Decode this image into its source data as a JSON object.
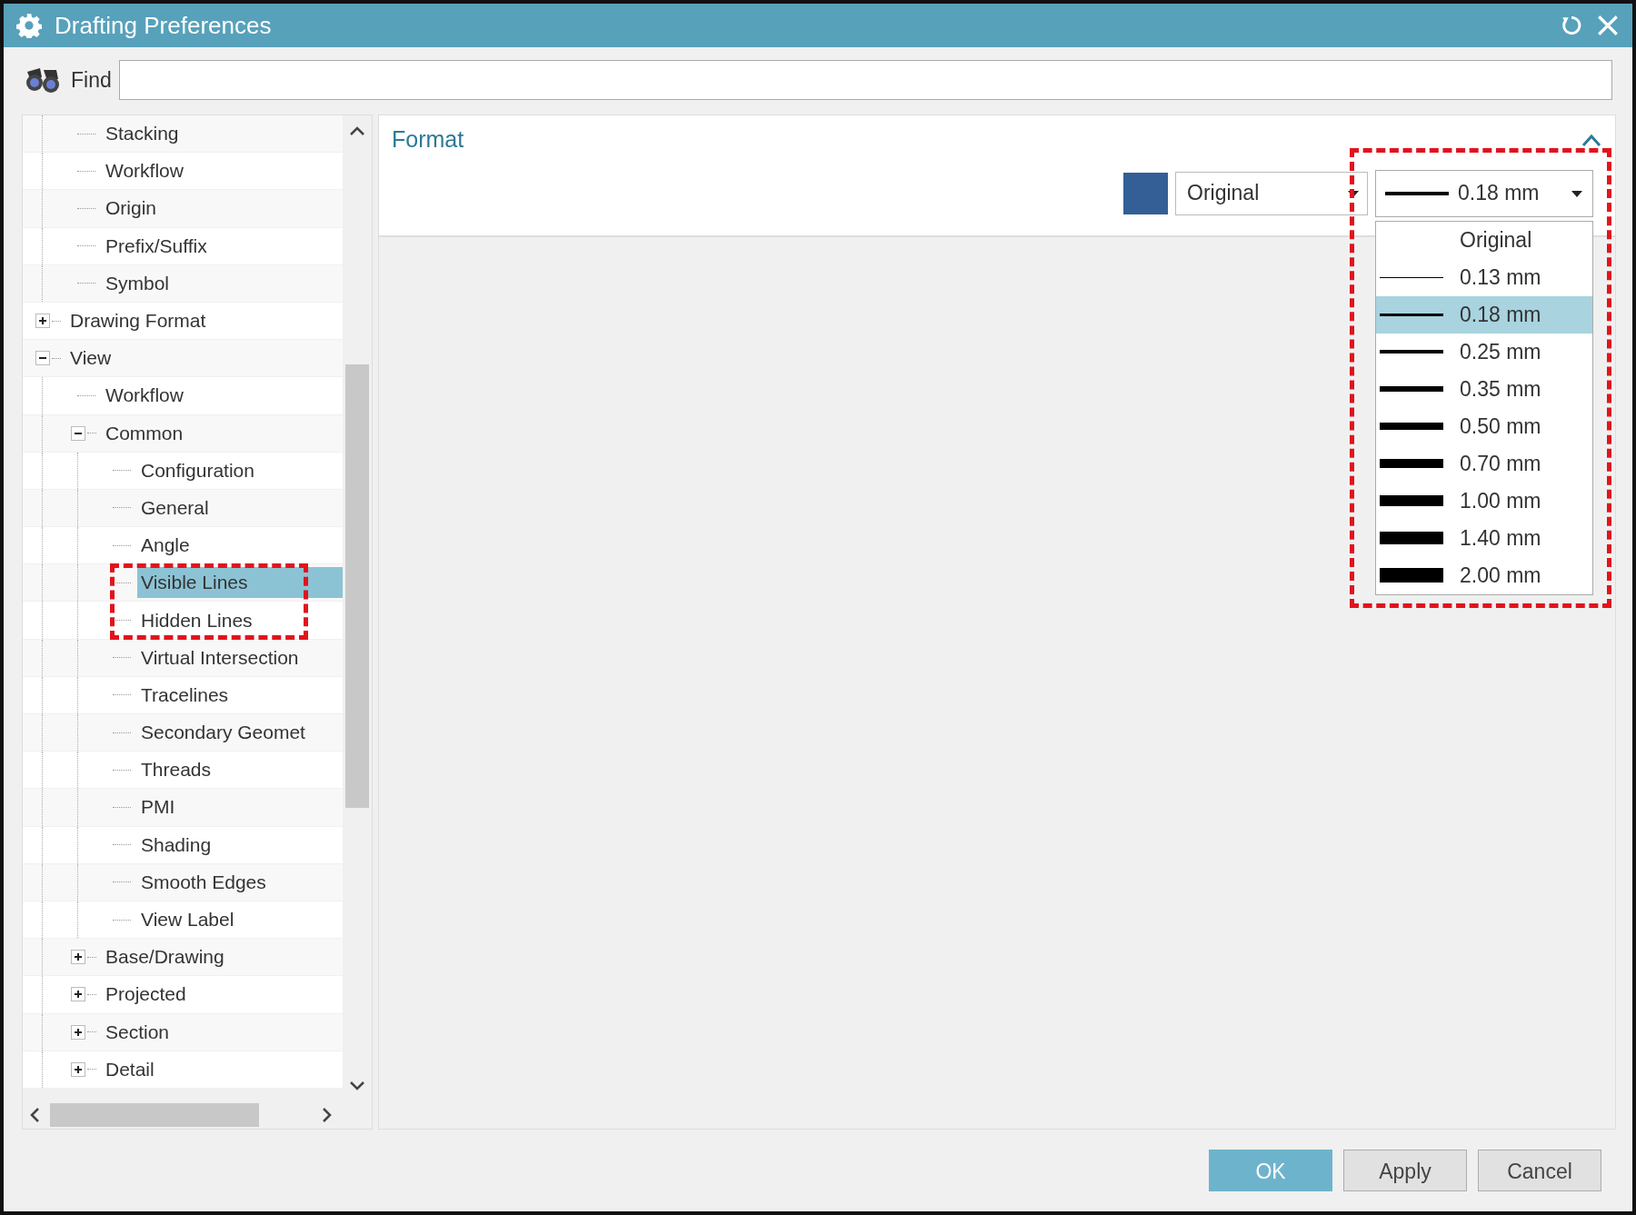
{
  "window": {
    "title": "Drafting Preferences"
  },
  "find": {
    "label": "Find"
  },
  "tree": {
    "items": [
      {
        "children": [
          {
            "label": "Stacking",
            "selected": false,
            "highlighted": false
          },
          {
            "label": "Workflow",
            "selected": false,
            "highlighted": false
          },
          {
            "label": "Origin",
            "selected": false,
            "highlighted": false
          },
          {
            "label": "Prefix/Suffix",
            "selected": false,
            "highlighted": false
          },
          {
            "label": "Symbol",
            "selected": false,
            "highlighted": false
          }
        ]
      },
      {
        "label": "Drawing Format",
        "expanded": false,
        "selected": false,
        "highlighted": false
      },
      {
        "label": "View",
        "expanded": true,
        "selected": false,
        "highlighted": false,
        "children": [
          {
            "label": "Workflow",
            "selected": false,
            "highlighted": false
          },
          {
            "label": "Common",
            "expanded": true,
            "selected": false,
            "highlighted": false,
            "children": [
              {
                "label": "Configuration",
                "selected": false,
                "highlighted": false
              },
              {
                "label": "General",
                "selected": false,
                "highlighted": false
              },
              {
                "label": "Angle",
                "selected": false,
                "highlighted": false
              },
              {
                "label": "Visible Lines",
                "selected": true,
                "highlighted": true
              },
              {
                "label": "Hidden Lines",
                "selected": false,
                "highlighted": true
              },
              {
                "label": "Virtual Intersection",
                "selected": false,
                "highlighted": false
              },
              {
                "label": "Tracelines",
                "selected": false,
                "highlighted": false
              },
              {
                "label": "Secondary Geomet",
                "selected": false,
                "highlighted": false
              },
              {
                "label": "Threads",
                "selected": false,
                "highlighted": false
              },
              {
                "label": "PMI",
                "selected": false,
                "highlighted": false
              },
              {
                "label": "Shading",
                "selected": false,
                "highlighted": false
              },
              {
                "label": "Smooth Edges",
                "selected": false,
                "highlighted": false
              },
              {
                "label": "View Label",
                "selected": false,
                "highlighted": false
              }
            ]
          },
          {
            "label": "Base/Drawing",
            "expanded": false,
            "selected": false,
            "highlighted": false
          },
          {
            "label": "Projected",
            "expanded": false,
            "selected": false,
            "highlighted": false
          },
          {
            "label": "Section",
            "expanded": false,
            "selected": false,
            "highlighted": false
          },
          {
            "label": "Detail",
            "expanded": false,
            "selected": false,
            "highlighted": false
          }
        ]
      }
    ]
  },
  "section": {
    "title": "Format",
    "expanded": true
  },
  "color_swatch": {
    "color": "#335f96"
  },
  "style_dropdown": {
    "value": "Original"
  },
  "width_dropdown": {
    "value": "0.18 mm",
    "expanded": true,
    "highlighted": true,
    "options": [
      {
        "label": "Original",
        "kind": "plain",
        "selected": false
      },
      {
        "label": "0.13 mm",
        "kind": "line",
        "selected": false
      },
      {
        "label": "0.18 mm",
        "kind": "line",
        "selected": true
      },
      {
        "label": "0.25 mm",
        "kind": "line",
        "selected": false
      },
      {
        "label": "0.35 mm",
        "kind": "line",
        "selected": false
      },
      {
        "label": "0.50 mm",
        "kind": "line",
        "selected": false
      },
      {
        "label": "0.70 mm",
        "kind": "line",
        "selected": false
      },
      {
        "label": "1.00 mm",
        "kind": "line",
        "selected": false
      },
      {
        "label": "1.40 mm",
        "kind": "line",
        "selected": false
      },
      {
        "label": "2.00 mm",
        "kind": "line",
        "selected": false
      }
    ]
  },
  "buttons": [
    {
      "label": "OK",
      "kind": "primary"
    },
    {
      "label": "Apply",
      "kind": "default"
    },
    {
      "label": "Cancel",
      "kind": "default"
    }
  ]
}
